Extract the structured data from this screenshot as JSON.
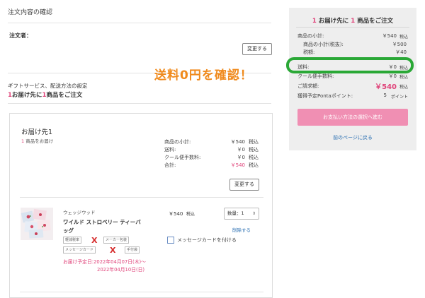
{
  "main": {
    "section_title": "注文内容の確認",
    "orderer_label": "注文者：",
    "change_button": "変更する",
    "gift_heading": "ギフトサービス、配送方法の設定",
    "dest_summary": {
      "n1": "1",
      "t1": "お届け先に",
      "n2": "1",
      "t2": "商品をご注文"
    }
  },
  "annotation": {
    "text": "送料0円を確認！",
    "color": "#f08a1c",
    "ring_color": "#2aa836"
  },
  "sidebar": {
    "header": {
      "n1": "1",
      "t1": " お届け先に ",
      "n2": "1",
      "t2": " 商品をご注文"
    },
    "rows": [
      {
        "label": "商品の小計:",
        "value": "￥540",
        "suffix": "税込"
      },
      {
        "label": "商品の小計(税抜):",
        "value": "￥500",
        "suffix": ""
      },
      {
        "label": "税額:",
        "value": "￥40",
        "suffix": ""
      },
      {
        "label": "送料:",
        "value": "￥0",
        "suffix": "税込"
      },
      {
        "label": "クール便手数料:",
        "value": "￥0",
        "suffix": "税込"
      },
      {
        "label": "ご請求額:",
        "value": "￥540",
        "suffix": "税込"
      },
      {
        "label": "獲得予定Pontaポイント:",
        "value": "5",
        "suffix": "ポイント"
      }
    ],
    "proceed_button": "お支払い方法の選択へ進む",
    "back_link": "前のページに戻る"
  },
  "destination": {
    "title": "お届け先1",
    "count_num": "1",
    "count_text": " 商品をお届け",
    "totals": [
      {
        "label": "商品の小計:",
        "value": "￥540",
        "suffix": "税込"
      },
      {
        "label": "送料:",
        "value": "￥0",
        "suffix": "税込"
      },
      {
        "label": "クール便手数料:",
        "value": "￥0",
        "suffix": "税込"
      },
      {
        "label": "合計:",
        "value": "￥540",
        "suffix": "税込"
      }
    ],
    "change_button": "変更する"
  },
  "product": {
    "brand": "ウェッジウッド",
    "name_line1": "ワイルド ストロベリー ティーバ",
    "name_line2": "ッグ",
    "price": "￥540",
    "tax": "税込",
    "quantity_label": "数量：1",
    "delete_link": "削除する",
    "message_card": "メッセージカードを付ける",
    "tags": [
      "軽減税率",
      "メーカー包装",
      "メッセージカード",
      "手付袋"
    ],
    "delivery_line1": "お届け予定日:2022年04月07日(木)～",
    "delivery_line2": "2022年04月10日(日)"
  }
}
